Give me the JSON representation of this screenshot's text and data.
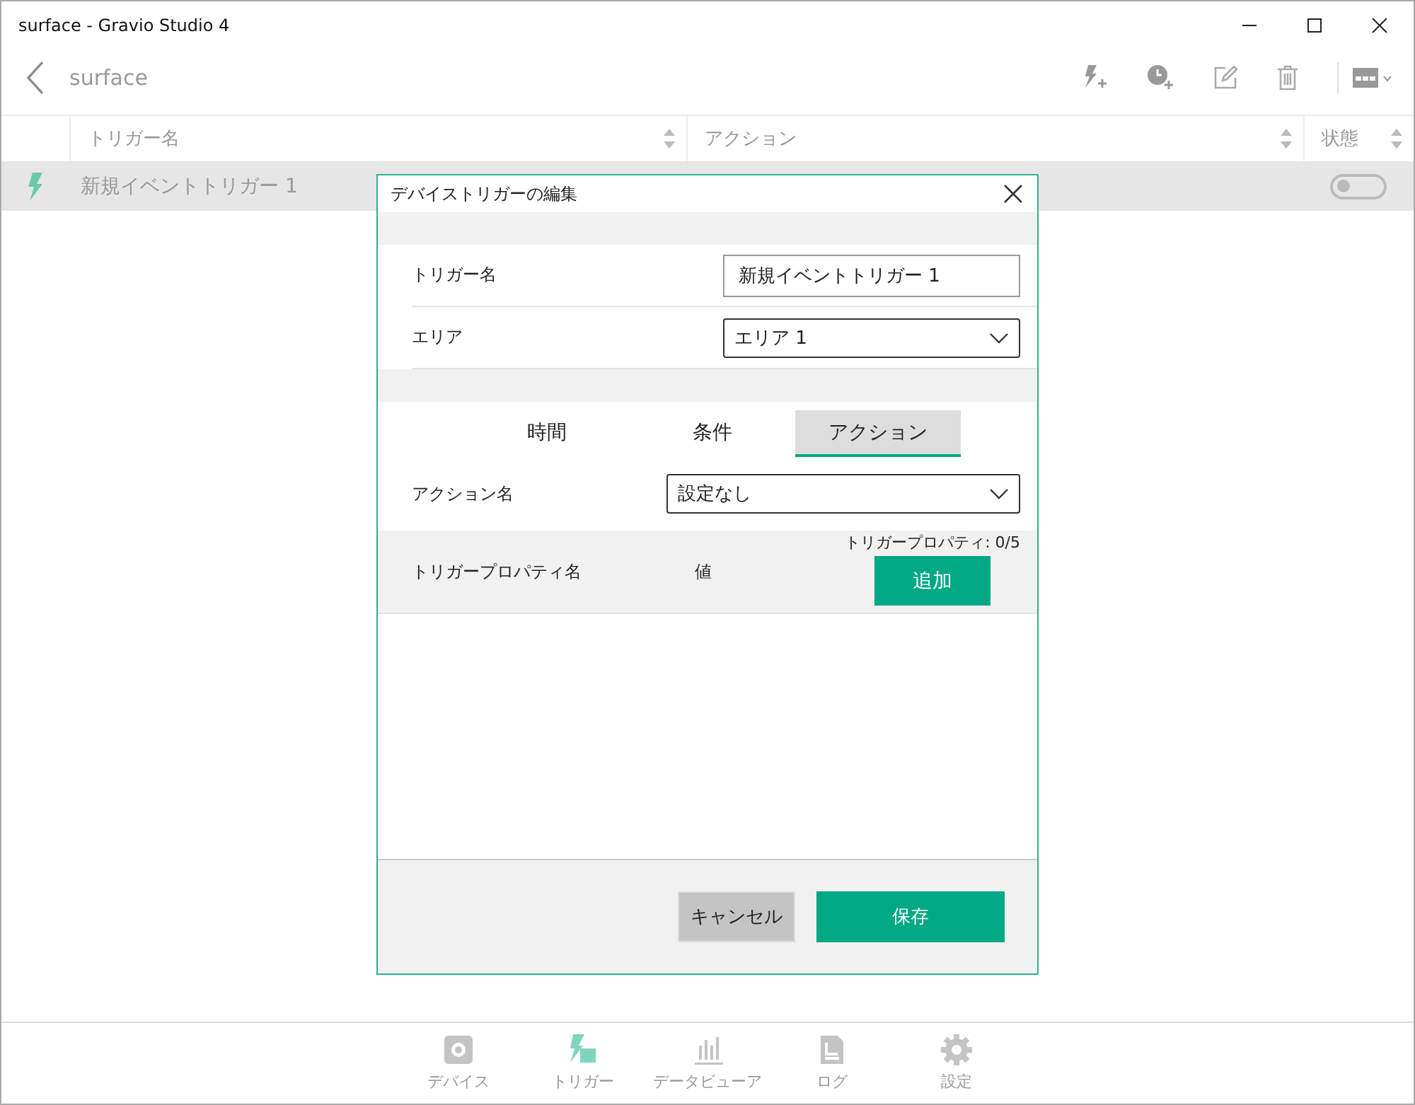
{
  "window": {
    "title": "surface - Gravio Studio 4"
  },
  "toolbar": {
    "title": "surface"
  },
  "table": {
    "columns": [
      {
        "label": "トリガー名"
      },
      {
        "label": "アクション"
      },
      {
        "label": "状態"
      }
    ],
    "rows": [
      {
        "name": "新規イベントトリガー 1",
        "on": false
      }
    ]
  },
  "dialog": {
    "title": "デバイストリガーの編集",
    "fields": [
      {
        "kind": "text",
        "label": "トリガー名",
        "value": "新規イベントトリガー 1"
      },
      {
        "kind": "dropdown",
        "label": "エリア",
        "value": "エリア 1"
      }
    ],
    "tabs": [
      {
        "label": "時間",
        "selected": false
      },
      {
        "label": "条件",
        "selected": false
      },
      {
        "label": "アクション",
        "selected": true
      }
    ],
    "action_name": {
      "label": "アクション名",
      "value": "設定なし"
    },
    "properties": {
      "columns": [
        "トリガープロパティ名",
        "値"
      ],
      "count": "トリガープロパティ: 0/5",
      "add_button": "追加"
    },
    "buttons": [
      {
        "kind": "secondary",
        "label": "キャンセル"
      },
      {
        "kind": "primary",
        "label": "保存"
      }
    ]
  },
  "nav": [
    {
      "kind": "device",
      "label": "デバイス",
      "selected": false
    },
    {
      "kind": "trigger",
      "label": "トリガー",
      "selected": true
    },
    {
      "kind": "dataviewer",
      "label": "データビューア",
      "selected": false
    },
    {
      "kind": "log",
      "label": "ログ",
      "selected": false
    },
    {
      "kind": "settings",
      "label": "設定",
      "selected": false
    }
  ]
}
